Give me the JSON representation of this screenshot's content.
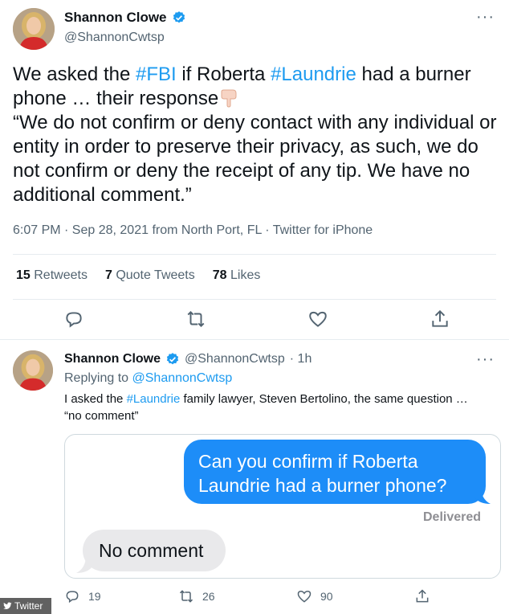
{
  "main_tweet": {
    "display_name": "Shannon Clowe",
    "handle": "@ShannonCwtsp",
    "more": "···",
    "text": {
      "line1_a": "We asked the ",
      "hashtag_fbi": "#FBI",
      "line1_b": " if Roberta ",
      "hashtag_laundrie": "#Laundrie",
      "line1_c": " had a burner phone … their response",
      "quote": "“We do not confirm or deny contact with any individual or entity in order to preserve their privacy, as such, we do not confirm or deny the receipt of any tip. We have no additional comment.”"
    },
    "meta": "6:07 PM · Sep 28, 2021 from North Port, FL · Twitter for iPhone",
    "stats": {
      "retweets_count": "15",
      "retweets_label": "Retweets",
      "quotes_count": "7",
      "quotes_label": "Quote Tweets",
      "likes_count": "78",
      "likes_label": "Likes"
    }
  },
  "reply_tweet": {
    "display_name": "Shannon Clowe",
    "handle": "@ShannonCwtsp",
    "time": "· 1h",
    "more": "···",
    "replying_label": "Replying to ",
    "replying_handle": "@ShannonCwtsp",
    "text_a": "I asked the ",
    "hashtag": "#Laundrie",
    "text_b": " family lawyer, Steven Bertolino, the same question …",
    "text_c": "“no comment”",
    "media": {
      "sent_message": "Can you confirm if Roberta Laundrie had a burner phone?",
      "delivered": "Delivered",
      "received_message": "No comment"
    },
    "counts": {
      "replies": "19",
      "retweets": "26",
      "likes": "90"
    }
  },
  "watermark": "Twitter",
  "colors": {
    "link_blue": "#1d9bf0",
    "imessage_blue": "#1d8df8",
    "bubble_grey": "#e9e9eb",
    "muted_text": "#536471"
  }
}
